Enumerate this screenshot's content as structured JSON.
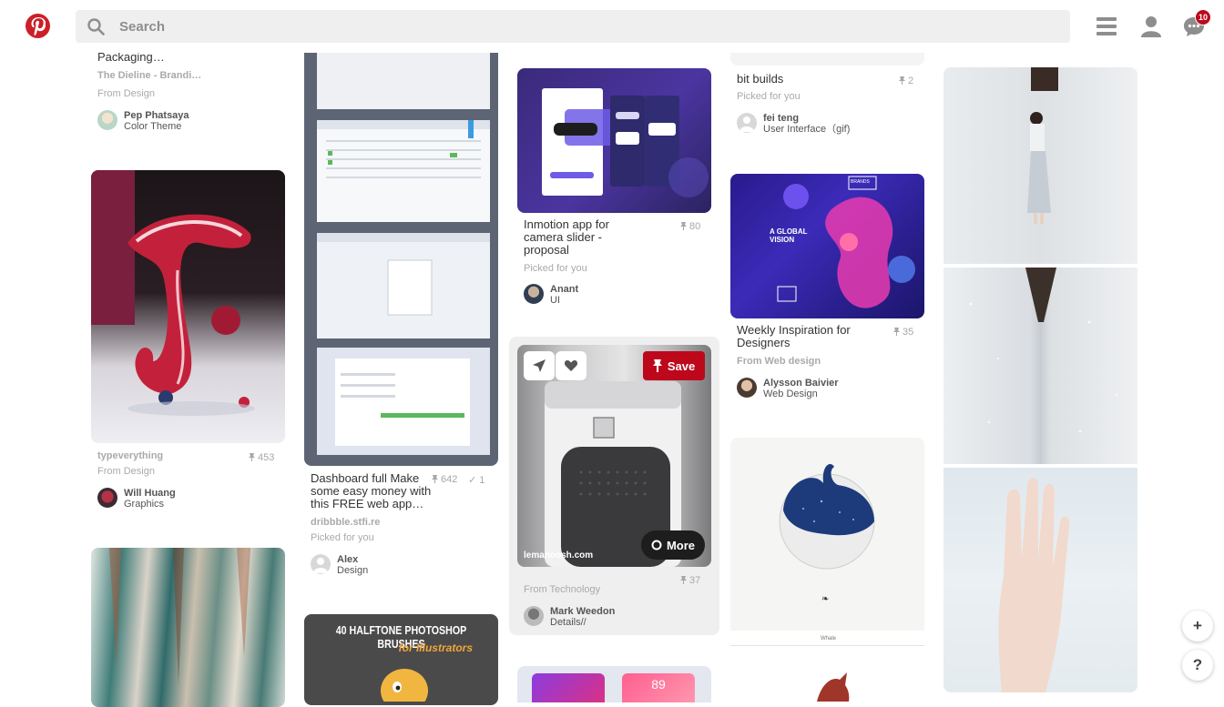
{
  "header": {
    "search_placeholder": "Search",
    "notifications_count": "10",
    "icons": [
      "pinterest-logo",
      "search-icon",
      "menu-icon",
      "profile-icon",
      "messages-icon"
    ]
  },
  "pins": {
    "packaging": {
      "title": "Packaging…",
      "source": "The Dieline - Brandi…",
      "from": "From Design",
      "user": "Pep Phatsaya",
      "board": "Color Theme"
    },
    "typeeverything": {
      "source": "typeverything",
      "count": "453",
      "from": "From Design",
      "user": "Will Huang",
      "board": "Graphics"
    },
    "dashboard": {
      "title_lines": [
        "Dashboard full Make",
        "some easy money with",
        "this FREE web app…"
      ],
      "pins_count": "642",
      "likes_count": "1",
      "source": "dribbble.stfi.re",
      "from": "Picked for you",
      "user": "Alex",
      "board": "Design"
    },
    "halftone": {
      "line1": "40 HALFTONE PHOTOSHOP BRUSHES",
      "line2": "for Illustrators"
    },
    "inmotion": {
      "title_lines": [
        "Inmotion app for",
        "camera slider -",
        "proposal"
      ],
      "count": "80",
      "from": "Picked for you",
      "user": "Anant",
      "board": "UI"
    },
    "speaker": {
      "save_label": "Save",
      "more_label": "More",
      "domain": "lemanoosh.com",
      "from": "From Technology",
      "count": "37",
      "user": "Mark Weedon",
      "board": "Details//"
    },
    "gradient_card": {
      "number": "89"
    },
    "bitbuilds": {
      "title": "bit builds",
      "count": "2",
      "from": "Picked for you",
      "user": "fei teng",
      "board": "User Interface（gif)"
    },
    "weekly": {
      "title_lines": [
        "Weekly Inspiration for",
        "Designers"
      ],
      "count": "35",
      "source": "From Web design",
      "user": "Alysson Baivier",
      "board": "Web Design",
      "image_text": [
        "A GLOBAL",
        "VISION",
        "BRANDS"
      ]
    },
    "whale": {
      "caption": "Whale"
    }
  },
  "floating": {
    "add_label": "+",
    "help_label": "?"
  },
  "colors": {
    "brand_red": "#bd081c",
    "search_bg": "#efefef",
    "muted_text": "#aaaaaa"
  }
}
